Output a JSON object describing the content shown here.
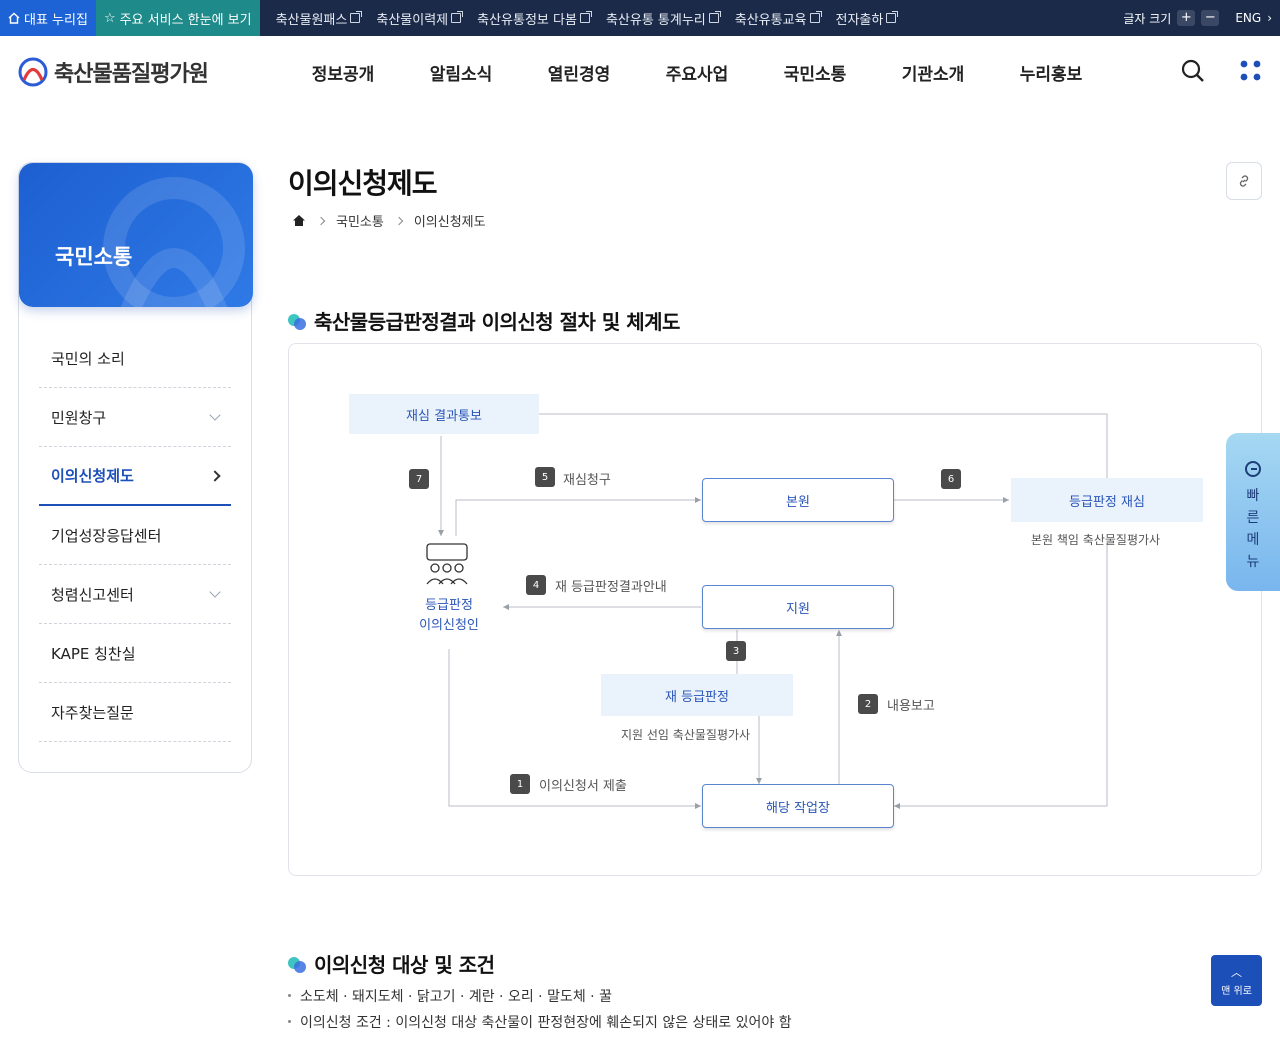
{
  "topbar": {
    "home_label": "대표 누리집",
    "services_label": "주요 서비스 한눈에 보기",
    "links": [
      "축산물원패스",
      "축산물이력제",
      "축산유통정보 다봄",
      "축산유통 통계누리",
      "축산유통교육",
      "전자출하"
    ],
    "font_size_label": "글자 크기",
    "plus": "+",
    "minus": "−",
    "lang": "ENG"
  },
  "header": {
    "logo_text": "축산물품질평가원",
    "nav": [
      "정보공개",
      "알림소식",
      "열린경영",
      "주요사업",
      "국민소통",
      "기관소개",
      "누리홍보"
    ]
  },
  "sidebar": {
    "title": "국민소통",
    "items": [
      {
        "label": "국민의 소리",
        "has_sub": false
      },
      {
        "label": "민원창구",
        "has_sub": true
      },
      {
        "label": "이의신청제도",
        "active": true
      },
      {
        "label": "기업성장응답센터",
        "has_sub": false
      },
      {
        "label": "청렴신고센터",
        "has_sub": true
      },
      {
        "label": "KAPE 칭찬실",
        "has_sub": false
      },
      {
        "label": "자주찾는질문",
        "has_sub": false
      }
    ]
  },
  "page": {
    "title": "이의신청제도",
    "breadcrumb": [
      "국민소통",
      "이의신청제도"
    ]
  },
  "section1": {
    "title": "축산물등급판정결과 이의신청 절차 및 체계도"
  },
  "diagram": {
    "n_result": "재심 결과통보",
    "n_hq": "본원",
    "n_review": "등급판정 재심",
    "n_review_sub": "본원 책임 축산물질평가사",
    "n_branch": "지원",
    "n_regrade": "재 등급판정",
    "n_regrade_sub": "지원 선임 축산물질평가사",
    "n_workplace": "해당 작업장",
    "applicant": [
      "등급판정",
      "이의신청인"
    ],
    "steps": [
      {
        "num": "1",
        "label": "이의신청서 제출"
      },
      {
        "num": "2",
        "label": "내용보고"
      },
      {
        "num": "3",
        "label": ""
      },
      {
        "num": "4",
        "label": "재 등급판정결과안내"
      },
      {
        "num": "5",
        "label": "재심청구"
      },
      {
        "num": "6",
        "label": ""
      },
      {
        "num": "7",
        "label": ""
      }
    ]
  },
  "section2": {
    "title": "이의신청 대상 및 조건",
    "bullets": [
      "소도체 · 돼지도체 · 닭고기 · 계란 · 오리 · 말도체 · 꿀",
      "이의신청 조건 : 이의신청 대상 축산물이 판정현장에 훼손되지 않은 상태로 있어야 함"
    ]
  },
  "floating": {
    "quick_menu": [
      "빠",
      "른",
      "메",
      "뉴"
    ],
    "top_button": "맨 위로"
  }
}
